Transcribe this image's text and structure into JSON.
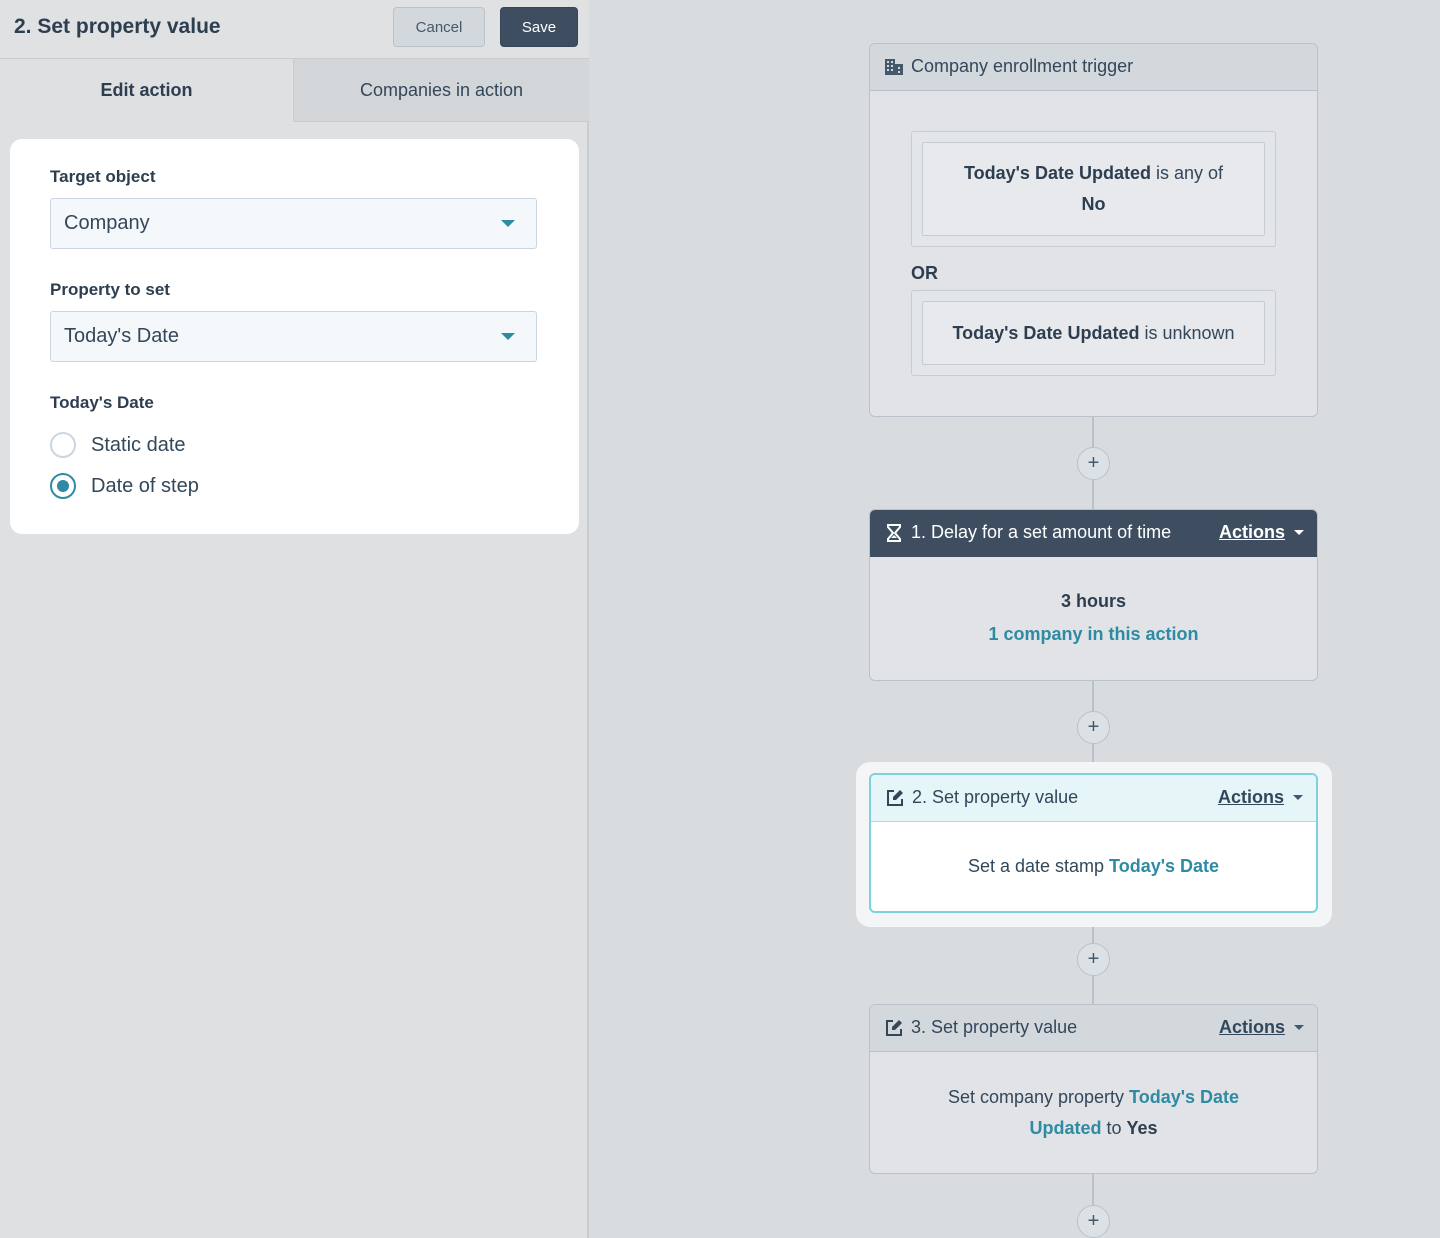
{
  "panel": {
    "title": "2. Set property value",
    "cancel_label": "Cancel",
    "save_label": "Save",
    "tabs": [
      {
        "label": "Edit action",
        "active": true
      },
      {
        "label": "Companies in action",
        "active": false
      }
    ],
    "form": {
      "target_object_label": "Target object",
      "target_object_value": "Company",
      "property_label": "Property to set",
      "property_value": "Today's Date",
      "date_label": "Today's Date",
      "options": [
        {
          "label": "Static date",
          "checked": false
        },
        {
          "label": "Date of step",
          "checked": true
        }
      ]
    }
  },
  "flow": {
    "trigger": {
      "title": "Company enrollment trigger",
      "icon": "building-icon",
      "condition1_prop": "Today's Date Updated",
      "condition1_op": " is any of",
      "condition1_value": "No",
      "or_label": "OR",
      "condition2_prop": "Today's Date Updated",
      "condition2_op": " is unknown"
    },
    "delay": {
      "title": "1. Delay for a set amount of time",
      "icon": "hourglass-icon",
      "actions_label": "Actions",
      "duration": "3 hours",
      "companies_link": "1 company in this action"
    },
    "step2": {
      "title": "2. Set property value",
      "icon": "edit-icon",
      "actions_label": "Actions",
      "text": "Set a date stamp ",
      "link": "Today's Date"
    },
    "step3": {
      "title": "3. Set property value",
      "icon": "edit-icon",
      "actions_label": "Actions",
      "text": "Set company property ",
      "link_line1": "Today's Date",
      "link_line2": "Updated",
      "to_text": " to ",
      "value": "Yes"
    },
    "plus_label": "+"
  },
  "colors": {
    "accent": "#2e8ba3",
    "dark_header": "#3e4e60",
    "text": "#33475b"
  }
}
